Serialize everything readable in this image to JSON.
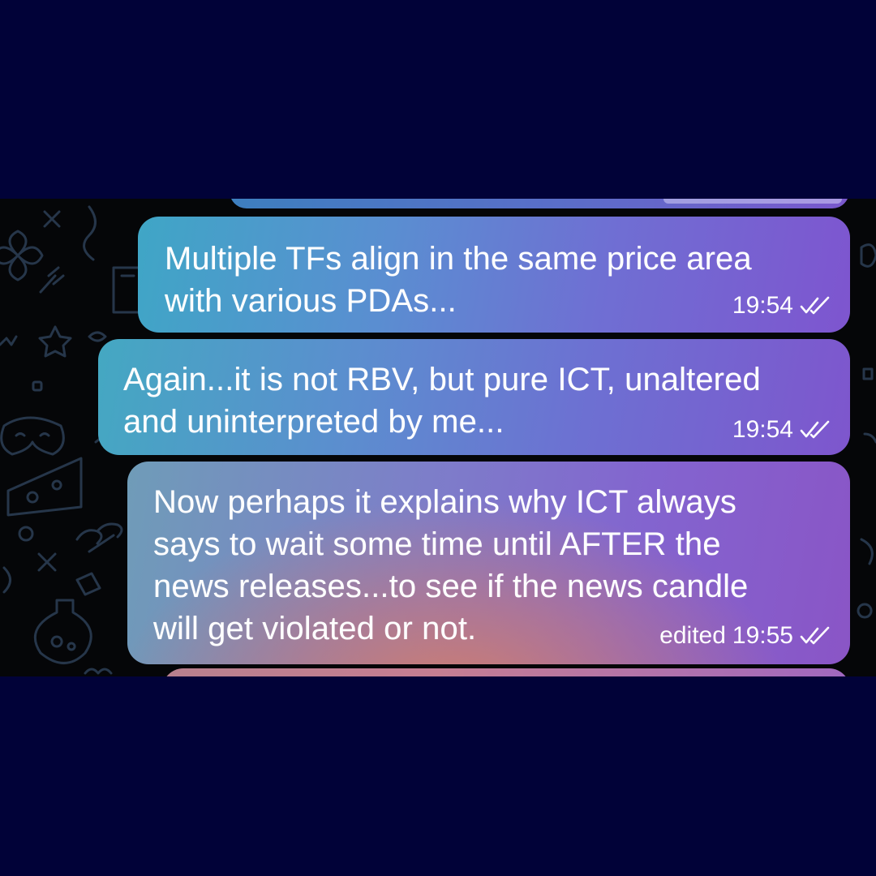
{
  "chat": {
    "messages": [
      {
        "text": "Multiple TFs align in the same price area\nwith various PDAs...",
        "edited_label": "",
        "time": "19:54",
        "status_icon": "double-check-icon"
      },
      {
        "text": "Again...it is not RBV, but pure ICT, unaltered\nand uninterpreted by me...",
        "edited_label": "",
        "time": "19:54",
        "status_icon": "double-check-icon"
      },
      {
        "text": "Now perhaps it explains why ICT always\nsays to wait some time until AFTER the\nnews releases...to see if the news candle\nwill get violated or not.",
        "edited_label": "edited",
        "time": "19:55",
        "status_icon": "double-check-icon"
      }
    ]
  },
  "colors": {
    "frame_background": "#010238",
    "chat_background": "#050608",
    "doodle_stroke": "#2a3a4a",
    "text": "#ffffff"
  }
}
